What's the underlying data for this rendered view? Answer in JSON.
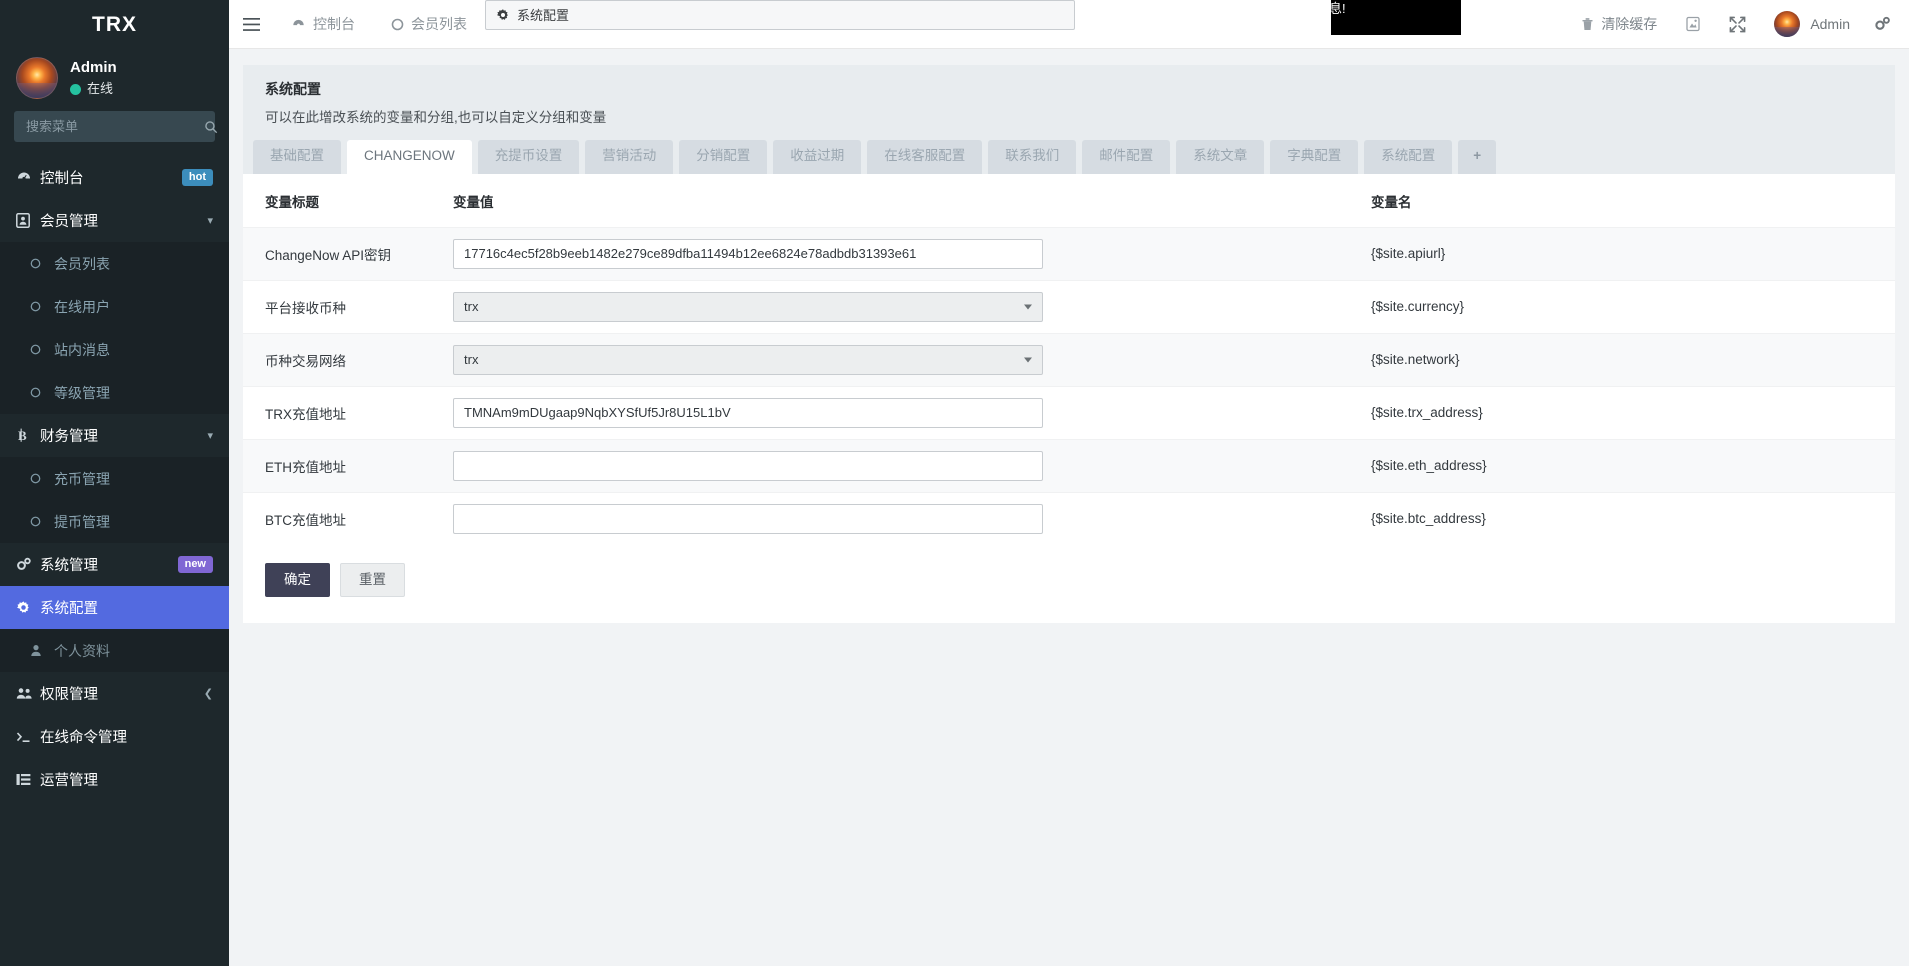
{
  "sidebar": {
    "brand": "TRX",
    "user": {
      "name": "Admin",
      "status": "在线"
    },
    "search": {
      "placeholder": "搜索菜单",
      "value": "",
      "icon": "search-icon"
    },
    "items": [
      {
        "label": "控制台",
        "icon": "dashboard-icon",
        "badge": "hot",
        "badge_type": "hot",
        "level": "top"
      },
      {
        "label": "会员管理",
        "icon": "id-card-icon",
        "caret": "chevron-down-icon",
        "level": "top"
      },
      {
        "label": "会员列表",
        "icon": "circle-icon",
        "level": "sub"
      },
      {
        "label": "在线用户",
        "icon": "circle-icon",
        "level": "sub"
      },
      {
        "label": "站内消息",
        "icon": "circle-icon",
        "level": "sub"
      },
      {
        "label": "等级管理",
        "icon": "circle-icon",
        "level": "sub"
      },
      {
        "label": "财务管理",
        "icon": "bitcoin-icon",
        "caret": "chevron-down-icon",
        "level": "top"
      },
      {
        "label": "充币管理",
        "icon": "circle-icon",
        "level": "sub"
      },
      {
        "label": "提币管理",
        "icon": "circle-icon",
        "level": "sub"
      },
      {
        "label": "系统管理",
        "icon": "cogs-icon",
        "badge": "new",
        "badge_type": "new",
        "level": "top"
      },
      {
        "label": "系统配置",
        "icon": "gear-icon",
        "level": "active"
      },
      {
        "label": "个人资料",
        "icon": "user-icon",
        "level": "sub-dim"
      },
      {
        "label": "权限管理",
        "icon": "users-icon",
        "caret": "chevron-left-icon",
        "level": "top"
      },
      {
        "label": "在线命令管理",
        "icon": "terminal-icon",
        "level": "top"
      },
      {
        "label": "运营管理",
        "icon": "list-icon",
        "level": "top"
      }
    ]
  },
  "topbar": {
    "menu_toggle_icon": "hamburger-icon",
    "nav_tabs": [
      {
        "label": "控制台",
        "icon": "dashboard-icon",
        "selected": false
      },
      {
        "label": "会员列表",
        "icon": "circle-icon",
        "selected": false
      },
      {
        "label": "系统配置",
        "icon": "gear-icon",
        "selected": true
      }
    ],
    "notice_fragment": "息!",
    "clear_cache": {
      "label": "清除缓存",
      "icon": "trash-icon"
    },
    "theme_icon": "theme-icon",
    "fullscreen_icon": "fullscreen-icon",
    "user_name": "Admin",
    "settings_icon": "cogs-icon"
  },
  "panel": {
    "title": "系统配置",
    "description": "可以在此增改系统的变量和分组,也可以自定义分组和变量"
  },
  "tabs": [
    {
      "label": "基础配置",
      "active": false
    },
    {
      "label": "CHANGENOW",
      "active": true
    },
    {
      "label": "充提币设置",
      "active": false
    },
    {
      "label": "营销活动",
      "active": false
    },
    {
      "label": "分销配置",
      "active": false
    },
    {
      "label": "收益过期",
      "active": false
    },
    {
      "label": "在线客服配置",
      "active": false
    },
    {
      "label": "联系我们",
      "active": false
    },
    {
      "label": "邮件配置",
      "active": false
    },
    {
      "label": "系统文章",
      "active": false
    },
    {
      "label": "字典配置",
      "active": false
    },
    {
      "label": "系统配置",
      "active": false
    },
    {
      "label": "+",
      "active": false,
      "is_plus": true
    }
  ],
  "table": {
    "headers": [
      "变量标题",
      "变量值",
      "变量名"
    ],
    "rows": [
      {
        "title": "ChangeNow API密钥",
        "type": "input",
        "value": "17716c4ec5f28b9eeb1482e279ce89dfba11494b12ee6824e78adbdb31393e61",
        "name": "{$site.apiurl}"
      },
      {
        "title": "平台接收币种",
        "type": "select",
        "value": "trx",
        "name": "{$site.currency}"
      },
      {
        "title": "币种交易网络",
        "type": "select",
        "value": "trx",
        "name": "{$site.network}"
      },
      {
        "title": "TRX充值地址",
        "type": "input",
        "value": "TMNAm9mDUgaap9NqbXYSfUf5Jr8U15L1bV",
        "name": "{$site.trx_address}"
      },
      {
        "title": "ETH充值地址",
        "type": "input",
        "value": "",
        "name": "{$site.eth_address}"
      },
      {
        "title": "BTC充值地址",
        "type": "input",
        "value": "",
        "name": "{$site.btc_address}"
      }
    ]
  },
  "buttons": {
    "submit": "确定",
    "reset": "重置"
  },
  "colors": {
    "sidebar_bg": "#1e282c",
    "active_menu": "#536ae0",
    "badge_hot": "#3c8dbc",
    "badge_new": "#8067d4",
    "primary_button": "#3f4157",
    "online_dot": "#25c2a0"
  }
}
